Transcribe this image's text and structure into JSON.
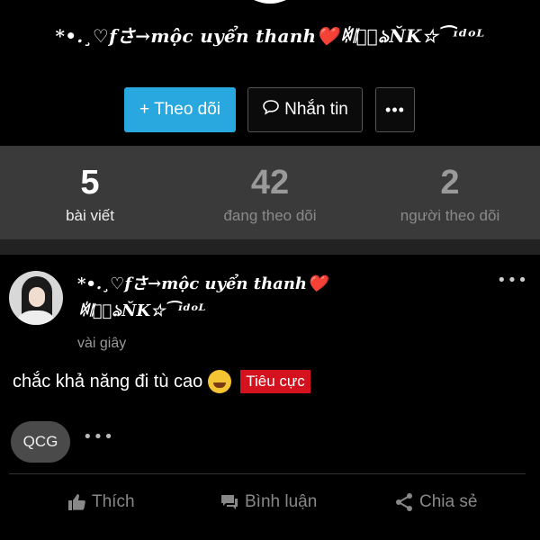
{
  "profile": {
    "name": "*•.¸♡fさ→mộc uyển thanh❤️ꉈ𝄁ঔ⃝ঌŇK☆⁀ᶦᵈᵒᴸ",
    "actions": {
      "follow_label": "Theo dõi",
      "message_label": "Nhắn tin",
      "more_label": "•••"
    },
    "colors": {
      "follow_bg": "#29a8e0",
      "tag_bg": "#d3121d"
    }
  },
  "stats": [
    {
      "value": "5",
      "label": "bài viết"
    },
    {
      "value": "42",
      "label": "đang theo dõi"
    },
    {
      "value": "2",
      "label": "người theo dõi"
    }
  ],
  "post": {
    "author_line1": "*•.¸♡fさ→mộc uyển thanh❤️",
    "author_line2": "ꉈ𝄁ঔ⃝ঌŇK☆⁀ᶦᵈᵒᴸ",
    "time": "vài giây",
    "content": "chắc khả năng đi tù cao",
    "tag": "Tiêu cực",
    "chip": "QCG",
    "more_label": "•••"
  },
  "actions": {
    "like": "Thích",
    "comment": "Bình luận",
    "share": "Chia sẻ"
  }
}
